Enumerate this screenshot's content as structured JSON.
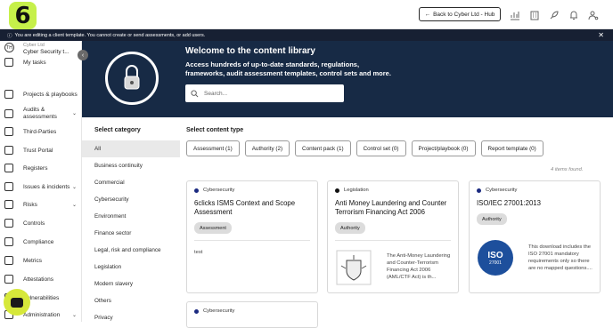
{
  "header": {
    "logo_text": "6",
    "back_label": "Back to Cyber Ltd - Hub",
    "icons": [
      "analytics-icon",
      "building-icon",
      "rocket-icon",
      "bell-icon",
      "user-settings-icon"
    ]
  },
  "notice": {
    "text": "You are editing a client template. You cannot create or send assessments, or add users.",
    "close": "✕"
  },
  "sidebar": {
    "avatar": "TH",
    "org_sub": "Cyber Ltd",
    "org_name": "Cyber Security t...",
    "items": [
      {
        "label": "My tasks",
        "icon": "tasks-icon"
      },
      {
        "label": "Projects & playbooks",
        "icon": "briefcase-icon"
      },
      {
        "label": "Audits & assessments",
        "icon": "audit-icon",
        "chevron": true
      },
      {
        "label": "Third-Parties",
        "icon": "third-party-icon"
      },
      {
        "label": "Trust Portal",
        "icon": "portal-icon"
      },
      {
        "label": "Registers",
        "icon": "register-icon"
      },
      {
        "label": "Issues & incidents",
        "icon": "issues-icon",
        "chevron": true
      },
      {
        "label": "Risks",
        "icon": "risk-icon",
        "chevron": true
      },
      {
        "label": "Controls",
        "icon": "controls-icon"
      },
      {
        "label": "Compliance",
        "icon": "compliance-icon"
      },
      {
        "label": "Metrics",
        "icon": "metrics-icon"
      },
      {
        "label": "Attestations",
        "icon": "attestations-icon"
      },
      {
        "label": "Vulnerabilities",
        "icon": "vulnerability-icon"
      },
      {
        "label": "Administration",
        "icon": "admin-icon",
        "chevron": true
      }
    ]
  },
  "hero": {
    "title": "Welcome to the content library",
    "subtitle": "Access hundreds of up-to-date standards, regulations, frameworks, audit assessment templates, control sets and more.",
    "search_placeholder": "Search..."
  },
  "categories": {
    "title": "Select category",
    "items": [
      "All",
      "Business continuity",
      "Commercial",
      "Cybersecurity",
      "Environment",
      "Finance sector",
      "Legal, risk and compliance",
      "Legislation",
      "Modern slavery",
      "Others",
      "Privacy"
    ]
  },
  "content_types": {
    "title": "Select content type",
    "items": [
      "Assessment (1)",
      "Authority (2)",
      "Content pack (1)",
      "Control set (0)",
      "Project/playbook (0)",
      "Report template (0)"
    ]
  },
  "results": {
    "count_text": "4 items found.",
    "cards": [
      {
        "category": "Cybersecurity",
        "title": "6clicks ISMS Context and Scope Assessment",
        "badge": "Assessment",
        "description": "test"
      },
      {
        "category": "Legislation",
        "title": "Anti Money Laundering and Counter Terrorism Financing Act 2006",
        "badge": "Authority",
        "description": "The Anti-Money Laundering and Counter-Terrorism Financing Act 2006 (AML/CTF Act) is th..."
      },
      {
        "category": "Cybersecurity",
        "title": "ISO/IEC 27001:2013",
        "badge": "Authority",
        "description": "This download includes the ISO 27001 mandatory requirements only so there are no mapped questions....",
        "logo_text": "ISO",
        "logo_sub": "27001"
      },
      {
        "category": "Cybersecurity"
      }
    ]
  },
  "colors": {
    "brand": "#c6f04a",
    "navy": "#172a45",
    "notice_bg": "#172033"
  }
}
